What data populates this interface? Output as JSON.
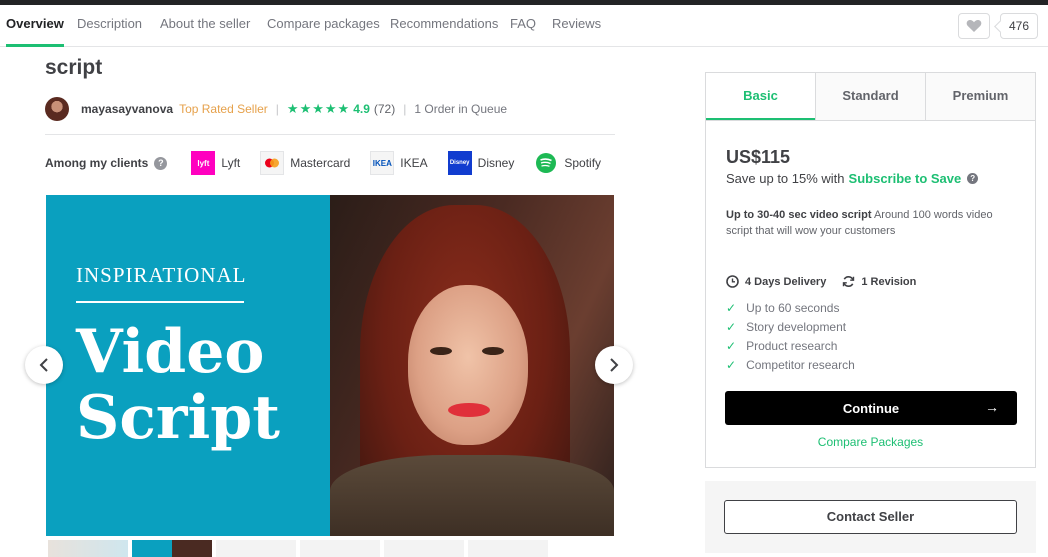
{
  "nav": {
    "tabs": [
      {
        "label": "Overview",
        "active": true
      },
      {
        "label": "Description"
      },
      {
        "label": "About the seller"
      },
      {
        "label": "Compare packages"
      },
      {
        "label": "Recommendations"
      },
      {
        "label": "FAQ"
      },
      {
        "label": "Reviews"
      }
    ],
    "save_count": "476"
  },
  "gig": {
    "title_fragment": "script",
    "seller_name": "mayasayvanova",
    "seller_badge": "Top Rated Seller",
    "rating": "4.9",
    "rating_count": "(72)",
    "queue": "1 Order in Queue",
    "stars": 5
  },
  "clients": {
    "label": "Among my clients",
    "items": [
      {
        "name": "Lyft",
        "logo_text": "lyft",
        "color": "#ff00bf"
      },
      {
        "name": "Mastercard",
        "logo_text": "",
        "color": "#eb001b"
      },
      {
        "name": "IKEA",
        "logo_text": "IKEA",
        "color": "#0051ba"
      },
      {
        "name": "Disney",
        "logo_text": "Disney",
        "color": "#113ccf"
      },
      {
        "name": "Spotify",
        "logo_text": "",
        "color": "#1db954"
      }
    ]
  },
  "gallery": {
    "line1": "INSPIRATIONAL",
    "line2": "Video",
    "line3": "Script",
    "accent_color": "#0aa0bf"
  },
  "package": {
    "tabs": [
      "Basic",
      "Standard",
      "Premium"
    ],
    "active_tab": "Basic",
    "price": "US$115",
    "save_text": "Save up to 15% with",
    "save_link": "Subscribe to Save",
    "desc_bold": "Up to 30-40 sec video script",
    "desc_rest": " Around 100 words video script that will wow your customers",
    "delivery": "4 Days Delivery",
    "revisions": "1 Revision",
    "features": [
      "Up to 60 seconds",
      "Story development",
      "Product research",
      "Competitor research"
    ],
    "continue_label": "Continue",
    "compare_label": "Compare Packages"
  },
  "contact": {
    "label": "Contact Seller"
  },
  "colors": {
    "brand_green": "#1dbf73",
    "top_rated": "#e6a14b"
  }
}
